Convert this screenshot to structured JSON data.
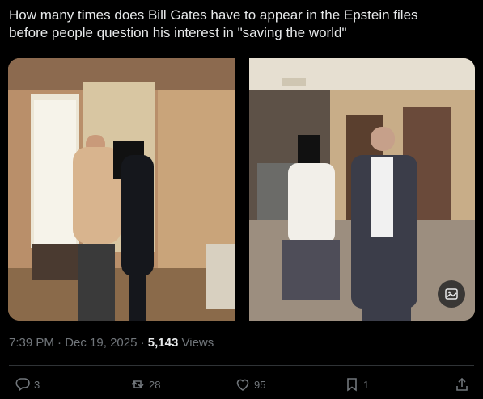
{
  "tweet": {
    "text": "How many times does Bill Gates have to appear in the Epstein files\nbefore people question his interest in \"saving the world\""
  },
  "media": {
    "images": [
      {
        "name": "left-photo",
        "watermark": "© ..."
      },
      {
        "name": "right-photo"
      }
    ],
    "edit_icon": "image-edit-icon"
  },
  "meta": {
    "time": "7:39 PM",
    "separator1": "·",
    "date": "Dec 19, 2025",
    "separator2": "·",
    "views_count": "5,143",
    "views_label": "Views"
  },
  "actions": {
    "replies": "3",
    "reposts": "28",
    "likes": "95",
    "bookmarks": "1"
  },
  "colors": {
    "background": "#000000",
    "text": "#e7e9ea",
    "muted": "#71767b",
    "divider": "#2f3336"
  }
}
